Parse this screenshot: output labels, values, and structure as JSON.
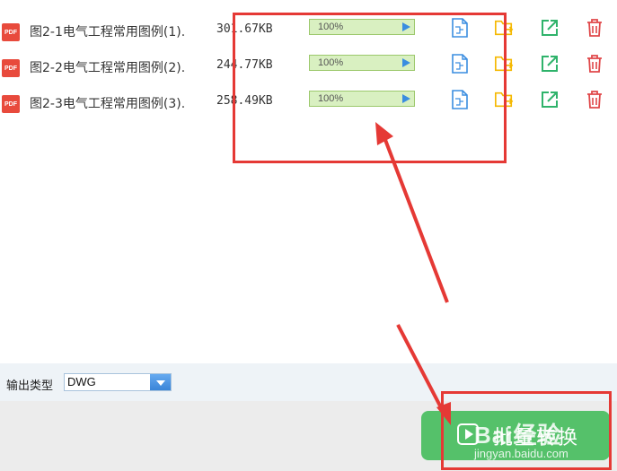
{
  "files": [
    {
      "name": "图2-1电气工程常用图例(1).",
      "size": "301.67KB",
      "progress": "100%",
      "progress_value": 100
    },
    {
      "name": "图2-2电气工程常用图例(2).",
      "size": "244.77KB",
      "progress": "100%",
      "progress_value": 100
    },
    {
      "name": "图2-3电气工程常用图例(3).",
      "size": "258.49KB",
      "progress": "100%",
      "progress_value": 100
    }
  ],
  "pdf_badge": "PDF",
  "output": {
    "label": "输出类型",
    "value": "DWG"
  },
  "convert_button": {
    "label": "批量转换"
  },
  "watermark": {
    "brand": "Bai经验",
    "url": "jingyan.baidu.com"
  },
  "icons": {
    "file_type": "pdf-icon",
    "preview": "preview-document-icon",
    "folder": "open-folder-icon",
    "open": "open-external-icon",
    "delete": "trash-icon",
    "play": "play-icon",
    "dropdown": "chevron-down-icon"
  },
  "colors": {
    "pdf_red": "#e84a3c",
    "progress_fill": "#d9f0c1",
    "preview_blue": "#3a8de0",
    "folder_yellow": "#f5b800",
    "open_green": "#2fb36b",
    "delete_red": "#e0484a",
    "button_green": "#55c16a",
    "annotation_red": "#e53935"
  }
}
